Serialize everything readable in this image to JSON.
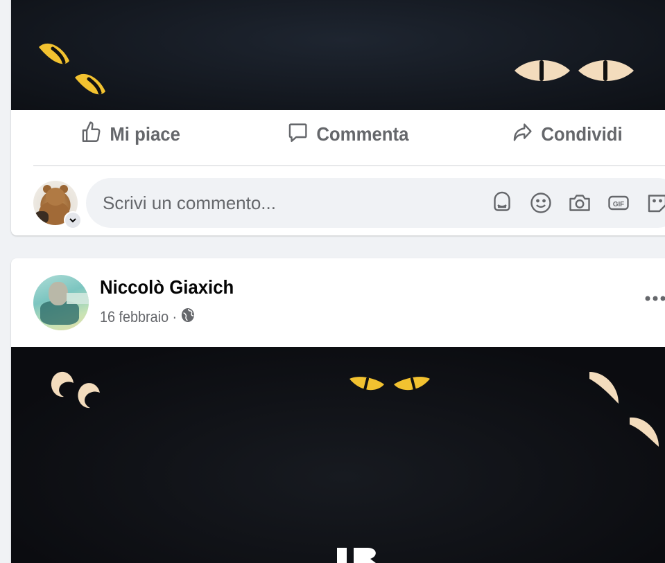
{
  "colors": {
    "page_bg": "#f0f2f5",
    "card_bg": "#ffffff",
    "muted_text": "#65676b",
    "eye_yellow": "#f2c230",
    "eye_cream": "#f3dcbd"
  },
  "post1": {
    "actions": {
      "like_label": "Mi piace",
      "comment_label": "Commenta",
      "share_label": "Condividi"
    },
    "comment_box": {
      "placeholder": "Scrivi un commento...",
      "tools": [
        "avatar-sticker-icon",
        "emoji-icon",
        "camera-icon",
        "gif-icon",
        "sticker-icon"
      ]
    }
  },
  "post2": {
    "author": "Niccolò Giaxich",
    "date": "16 febbraio",
    "separator": "·",
    "privacy": "globe-icon"
  }
}
